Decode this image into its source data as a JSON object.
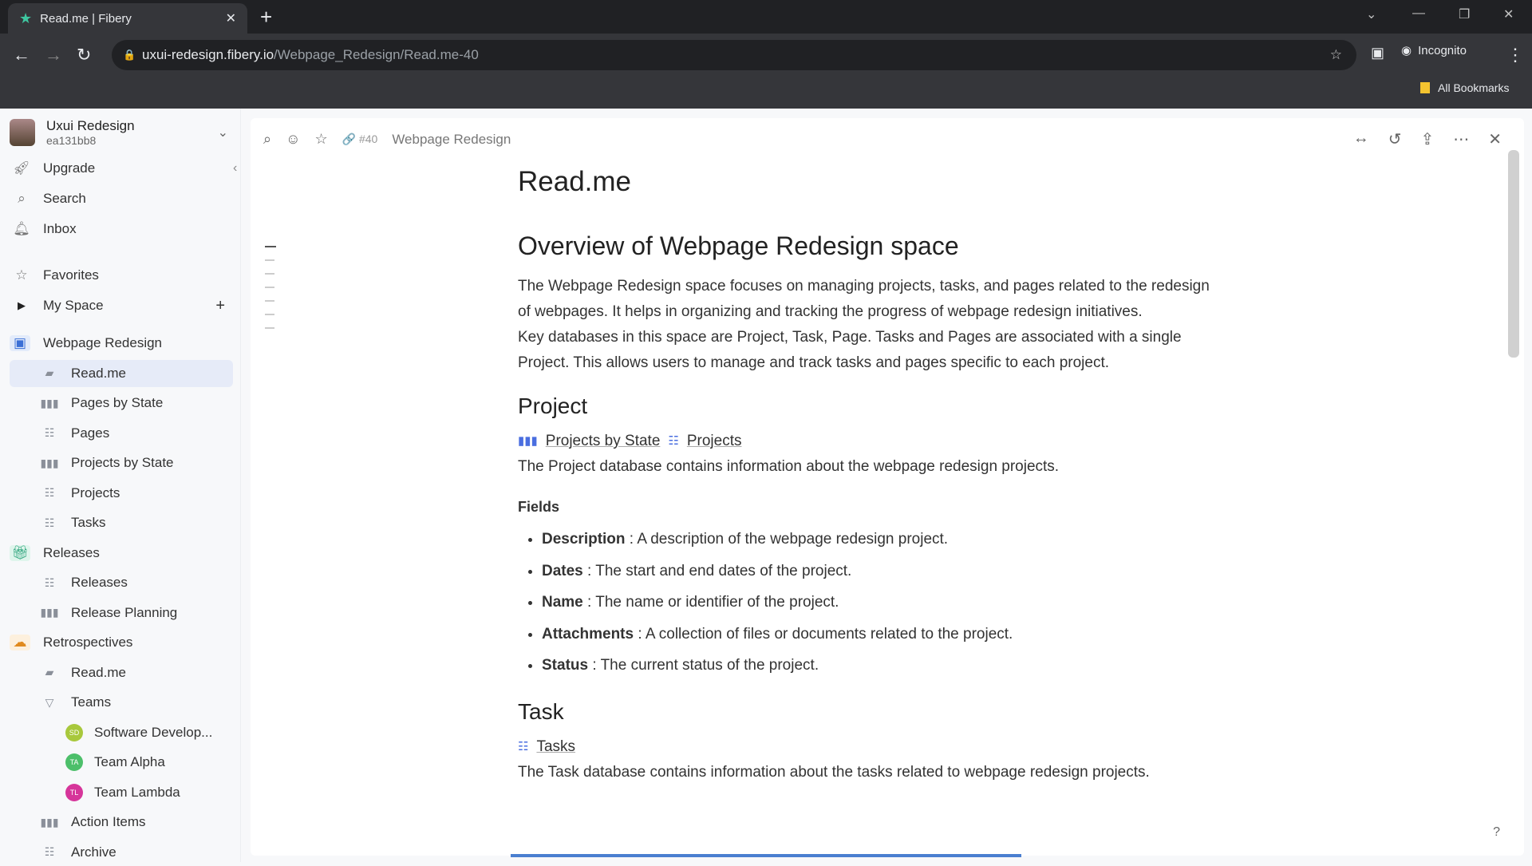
{
  "browser": {
    "tab_title": "Read.me | Fibery",
    "url_host": "uxui-redesign.fibery.io",
    "url_path": "/Webpage_Redesign/Read.me-40",
    "profile": "Incognito",
    "bookmarks": "All Bookmarks"
  },
  "workspace": {
    "name": "Uxui Redesign",
    "id": "ea131bb8"
  },
  "sidebar": {
    "top": [
      {
        "label": "Upgrade",
        "icon": "rocket-icon"
      },
      {
        "label": "Search",
        "icon": "search-icon"
      },
      {
        "label": "Inbox",
        "icon": "bell-icon"
      },
      {
        "label": "Favorites",
        "icon": "star-icon"
      },
      {
        "label": "My Space",
        "icon": "caret-right-icon"
      }
    ],
    "items": [
      {
        "label": "Webpage Redesign",
        "level": 0
      },
      {
        "label": "Read.me",
        "level": 1
      },
      {
        "label": "Pages by State",
        "level": 1
      },
      {
        "label": "Pages",
        "level": 1
      },
      {
        "label": "Projects by State",
        "level": 1
      },
      {
        "label": "Projects",
        "level": 1
      },
      {
        "label": "Tasks",
        "level": 1
      },
      {
        "label": "Releases",
        "level": 0
      },
      {
        "label": "Releases",
        "level": 1
      },
      {
        "label": "Release Planning",
        "level": 1
      },
      {
        "label": "Retrospectives",
        "level": 0
      },
      {
        "label": "Read.me",
        "level": 1
      },
      {
        "label": "Teams",
        "level": 1
      },
      {
        "label": "Software Develop...",
        "level": 2,
        "badge": "SD",
        "color": "#a8c83c"
      },
      {
        "label": "Team Alpha",
        "level": 2,
        "badge": "TA",
        "color": "#4cbf6a"
      },
      {
        "label": "Team Lambda",
        "level": 2,
        "badge": "TL",
        "color": "#d6359a"
      },
      {
        "label": "Action Items",
        "level": 1
      },
      {
        "label": "Archive",
        "level": 1
      }
    ]
  },
  "header": {
    "id": "#40",
    "breadcrumb": "Webpage Redesign"
  },
  "doc": {
    "title": "Read.me",
    "overview_heading": "Overview of Webpage Redesign space",
    "overview_p1": "The Webpage Redesign space focuses on managing projects, tasks, and pages related to the redesign of webpages. It helps in organizing and tracking the progress of webpage redesign initiatives.",
    "overview_p2": "Key databases in this space are Project, Task, Page. Tasks and Pages are associated with a single Project. This allows users to manage and track tasks and pages specific to each project.",
    "project_heading": "Project",
    "project_link1": "Projects by State",
    "project_link2": "Projects",
    "project_desc": "The Project database contains information about the webpage redesign projects.",
    "fields_label": "Fields",
    "fields": [
      {
        "name": "Description",
        "desc": " : A description of the webpage redesign project."
      },
      {
        "name": "Dates",
        "desc": " : The start and end dates of the project."
      },
      {
        "name": "Name",
        "desc": " : The name or identifier of the project."
      },
      {
        "name": "Attachments",
        "desc": " : A collection of files or documents related to the project."
      },
      {
        "name": "Status",
        "desc": " : The current status of the project."
      }
    ],
    "task_heading": "Task",
    "task_link": "Tasks",
    "task_desc": "The Task database contains information about the tasks related to webpage redesign projects."
  },
  "help": "?"
}
